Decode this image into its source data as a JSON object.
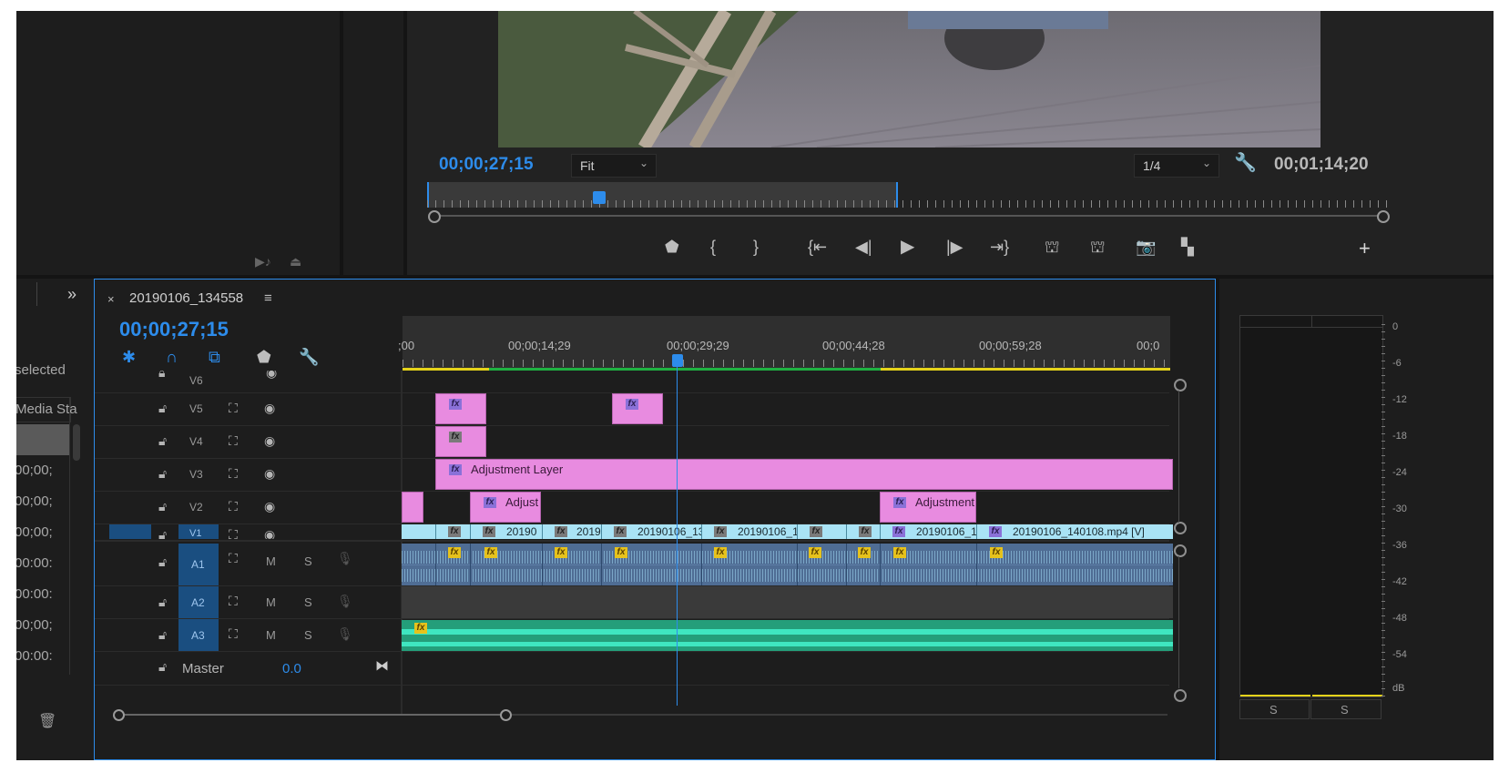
{
  "program_monitor": {
    "timecode_current": "00;00;27;15",
    "zoom_select": "Fit",
    "resolution_select": "1/4",
    "timecode_duration": "00;01;14;20"
  },
  "left_panel": {
    "selected_text": "selected",
    "media_start_text": "Media Sta",
    "rows": [
      "00;00;",
      "00;00;",
      "00;00;",
      "00:00:",
      "00:00:",
      "00;00;",
      "00:00:"
    ]
  },
  "sequence": {
    "tab_name": "20190106_134558",
    "timecode": "00;00;27;15",
    "ruler_labels": [
      ";00",
      "00;00;14;29",
      "00;00;29;29",
      "00;00;44;28",
      "00;00;59;28",
      "00;0"
    ],
    "tracks": {
      "video": [
        {
          "label": "V6"
        },
        {
          "label": "V5"
        },
        {
          "label": "V4"
        },
        {
          "label": "V3"
        },
        {
          "label": "V2"
        },
        {
          "label": "V1"
        }
      ],
      "audio": [
        {
          "label": "A1",
          "m": "M",
          "s": "S"
        },
        {
          "label": "A2",
          "m": "M",
          "s": "S"
        },
        {
          "label": "A3",
          "m": "M",
          "s": "S"
        }
      ],
      "master_label": "Master",
      "master_value": "0.0"
    },
    "clips": {
      "v3_adjustment": "Adjustment Layer",
      "v2_adjust_1": "Adjust",
      "v2_adjust_2": "Adjustment",
      "v1_names": [
        "20190",
        "2019",
        "20190106_13",
        "20190106_1",
        "20190106_1",
        "20190106_140108.mp4 [V]"
      ],
      "fx_label": "fx"
    }
  },
  "meter": {
    "db_labels": [
      "0",
      "-6",
      "-12",
      "-18",
      "-24",
      "-30",
      "-36",
      "-42",
      "-48",
      "-54",
      "dB"
    ],
    "solo_buttons": [
      "S",
      "S"
    ]
  },
  "colors": {
    "accent_blue": "#2d8ceb",
    "clip_pink": "#e88be0",
    "clip_cyan": "#a9e3f5",
    "audio_blue": "#4f6d94",
    "audio_green": "#2fc99a",
    "fx_yellow": "#e6c21c"
  }
}
